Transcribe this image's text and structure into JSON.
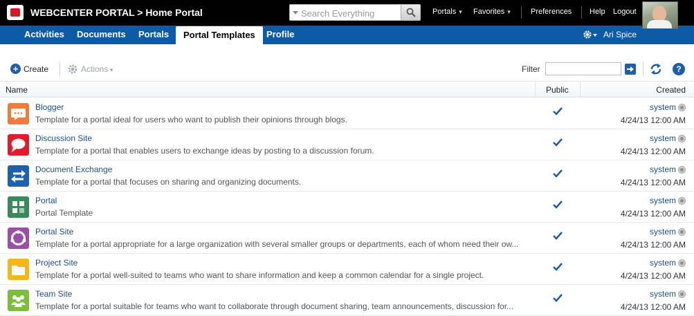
{
  "header": {
    "brand": "WEBCENTER PORTAL > Home Portal",
    "search_placeholder": "Search Everything",
    "links": {
      "portals": "Portals",
      "favorites": "Favorites",
      "preferences": "Preferences",
      "help": "Help",
      "logout": "Logout"
    }
  },
  "nav": {
    "tabs": [
      "Activities",
      "Documents",
      "Portals",
      "Portal Templates",
      "Profile"
    ],
    "active_tab": "Portal Templates",
    "user": "Ari Spice"
  },
  "toolbar": {
    "create": "Create",
    "actions": "Actions",
    "filter_label": "Filter",
    "filter_value": ""
  },
  "table": {
    "columns": {
      "name": "Name",
      "public": "Public",
      "created": "Created"
    },
    "rows": [
      {
        "name": "Blogger",
        "description": "Template for a portal ideal for users who want to publish their opinions through blogs.",
        "public": true,
        "created_by": "system",
        "created": "4/24/13 12:00 AM",
        "icon": "chat-bubble-icon",
        "color": "#ef7c3a"
      },
      {
        "name": "Discussion Site",
        "description": "Template for a portal that enables users to exchange ideas by posting to a discussion forum.",
        "public": true,
        "created_by": "system",
        "created": "4/24/13 12:00 AM",
        "icon": "speech-bubble-icon",
        "color": "#e3192c"
      },
      {
        "name": "Document Exchange",
        "description": "Template for a portal that focuses on sharing and organizing documents.",
        "public": true,
        "created_by": "system",
        "created": "4/24/13 12:00 AM",
        "icon": "exchange-arrows-icon",
        "color": "#1e62ad"
      },
      {
        "name": "Portal",
        "description": "Portal Template",
        "public": true,
        "created_by": "system",
        "created": "4/24/13 12:00 AM",
        "icon": "grid-squares-icon",
        "color": "#3a8a5c"
      },
      {
        "name": "Portal Site",
        "description": "Template for a portal appropriate for a large organization with several smaller groups or departments, each of whom need their ow...",
        "public": true,
        "created_by": "system",
        "created": "4/24/13 12:00 AM",
        "icon": "ring-icon",
        "color": "#9b4fa8"
      },
      {
        "name": "Project Site",
        "description": "Template for a portal well-suited to teams who want to share information and keep a common calendar for a single project.",
        "public": true,
        "created_by": "system",
        "created": "4/24/13 12:00 AM",
        "icon": "folder-icon",
        "color": "#f4b71b"
      },
      {
        "name": "Team Site",
        "description": "Template for a portal suitable for teams who want to collaborate through document sharing, team announcements, discussion for...",
        "public": true,
        "created_by": "system",
        "created": "4/24/13 12:00 AM",
        "icon": "people-icon",
        "color": "#7cbf3a"
      }
    ]
  }
}
